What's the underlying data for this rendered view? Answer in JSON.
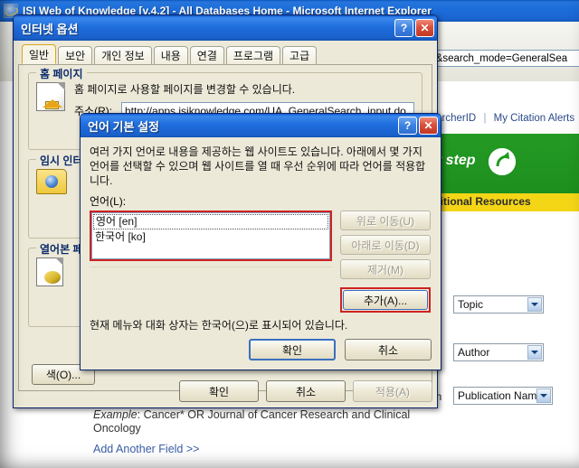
{
  "browser": {
    "title": "ISI Web of Knowledge [v.4.2] - All Databases Home - Microsoft Internet Explorer",
    "address_value": "A&search_mode=GeneralSea",
    "links": {
      "researcher_id": "searcherID",
      "separator": "|",
      "citation_alerts": "My Citation Alerts"
    },
    "green_banner_text": "xt step",
    "yellow_banner_text": "dditional Resources",
    "field_selects": [
      {
        "name": "topic",
        "value": "Topic"
      },
      {
        "name": "author",
        "value": "Author"
      },
      {
        "name": "publication-name",
        "value": "Publication Name"
      }
    ],
    "in_label": "in",
    "example_prefix": "Example",
    "example_text": ": Cancer* OR Journal of Cancer Research and Clinical Oncology",
    "add_another_field": "Add Another Field >>"
  },
  "internet_options": {
    "title": "인터넷 옵션",
    "help_button": "?",
    "close_button": "✕",
    "tabs": [
      {
        "label": "일반",
        "active": true
      },
      {
        "label": "보안",
        "active": false
      },
      {
        "label": "개인 정보",
        "active": false
      },
      {
        "label": "내용",
        "active": false
      },
      {
        "label": "연결",
        "active": false
      },
      {
        "label": "프로그램",
        "active": false
      },
      {
        "label": "고급",
        "active": false
      }
    ],
    "home_group": {
      "title": "홈 페이지",
      "description": "홈 페이지로 사용할 페이지를 변경할 수 있습니다.",
      "address_label": "주소(R):",
      "address_value": "http://apps.isiknowledge.com/UA_GeneralSearch_input.do"
    },
    "temp_group": {
      "title": "임시 인터넷 파일"
    },
    "history_group": {
      "title": "열어본 페이지 목록"
    },
    "color_button": "색(O)...",
    "buttons": {
      "ok": "확인",
      "cancel": "취소",
      "apply": "적용(A)"
    }
  },
  "language_dialog": {
    "title": "언어 기본 설정",
    "help_button": "?",
    "close_button": "✕",
    "description": "여러 가지 언어로 내용을 제공하는 웹 사이트도 있습니다. 아래에서 몇 가지 언어를 선택할 수 있으며 웹 사이트를 열 때 우선 순위에 따라 언어를 적용합니다.",
    "list_label": "언어(L):",
    "languages": [
      {
        "label": "영어 [en]",
        "focused": true
      },
      {
        "label": "한국어 [ko]",
        "focused": false
      }
    ],
    "side_buttons": [
      {
        "label": "위로 이동(U)",
        "enabled": false
      },
      {
        "label": "아래로 이동(D)",
        "enabled": false
      },
      {
        "label": "제거(M)",
        "enabled": false
      }
    ],
    "add_button": {
      "label": "추가(A)...",
      "enabled": true,
      "highlighted": true
    },
    "note": "현재 메뉴와 대화 상자는 한국어(으)로 표시되어 있습니다.",
    "buttons": {
      "ok": "확인",
      "cancel": "취소"
    }
  },
  "colors": {
    "title_blue": "#1f6ede",
    "dialog_face": "#ece9d8",
    "highlight_red": "#cf2222",
    "banner_green": "#1f9c1f",
    "banner_yellow": "#f4d617",
    "link_blue": "#3b5ea8"
  }
}
